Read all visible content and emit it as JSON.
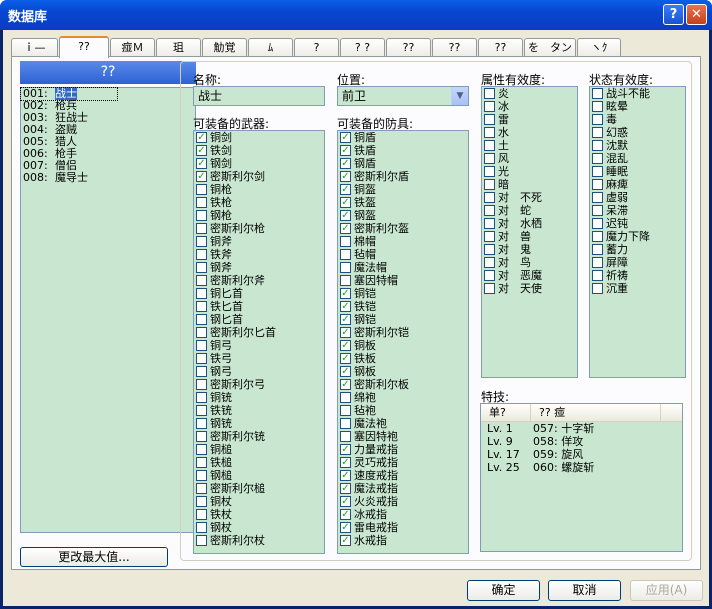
{
  "window": {
    "title": "数据库",
    "help_label": "?",
    "close_label": "✕"
  },
  "tabs": [
    "ｉ—",
    "??",
    "痖Ｍ",
    "珇",
    "觔覚",
    "ﾑ",
    "?",
    "? ?",
    "??",
    "??",
    "??",
    "を　タン",
    "ヽｸ"
  ],
  "left": {
    "header": "??",
    "button": "更改最大值...",
    "items": [
      {
        "num": "001:",
        "name": "战士"
      },
      {
        "num": "002:",
        "name": "枪兵"
      },
      {
        "num": "003:",
        "name": "狂战士"
      },
      {
        "num": "004:",
        "name": "盗贼"
      },
      {
        "num": "005:",
        "name": "猎人"
      },
      {
        "num": "006:",
        "name": "枪手"
      },
      {
        "num": "007:",
        "name": "僧侣"
      },
      {
        "num": "008:",
        "name": "魔导士"
      }
    ]
  },
  "form": {
    "name_label": "名称:",
    "name_value": "战士",
    "pos_label": "位置:",
    "pos_value": "前卫",
    "weapons_label": "可装备的武器:",
    "armor_label": "可装备的防具:",
    "attr_label": "属性有效度:",
    "state_label": "状态有效度:",
    "skill_label": "特技:"
  },
  "weapons": [
    {
      "t": "铜剑",
      "c": true
    },
    {
      "t": "铁剑",
      "c": true
    },
    {
      "t": "钢剑",
      "c": true
    },
    {
      "t": "密斯利尔剑",
      "c": true
    },
    {
      "t": "铜枪",
      "c": false
    },
    {
      "t": "铁枪",
      "c": false
    },
    {
      "t": "钢枪",
      "c": false
    },
    {
      "t": "密斯利尔枪",
      "c": false
    },
    {
      "t": "铜斧",
      "c": false
    },
    {
      "t": "铁斧",
      "c": false
    },
    {
      "t": "钢斧",
      "c": false
    },
    {
      "t": "密斯利尔斧",
      "c": false
    },
    {
      "t": "铜匕首",
      "c": false
    },
    {
      "t": "铁匕首",
      "c": false
    },
    {
      "t": "钢匕首",
      "c": false
    },
    {
      "t": "密斯利尔匕首",
      "c": false
    },
    {
      "t": "铜弓",
      "c": false
    },
    {
      "t": "铁弓",
      "c": false
    },
    {
      "t": "钢弓",
      "c": false
    },
    {
      "t": "密斯利尔弓",
      "c": false
    },
    {
      "t": "铜铳",
      "c": false
    },
    {
      "t": "铁铳",
      "c": false
    },
    {
      "t": "钢铳",
      "c": false
    },
    {
      "t": "密斯利尔铳",
      "c": false
    },
    {
      "t": "铜槌",
      "c": false
    },
    {
      "t": "铁槌",
      "c": false
    },
    {
      "t": "钢槌",
      "c": false
    },
    {
      "t": "密斯利尔槌",
      "c": false
    },
    {
      "t": "铜杖",
      "c": false
    },
    {
      "t": "铁杖",
      "c": false
    },
    {
      "t": "钢杖",
      "c": false
    },
    {
      "t": "密斯利尔杖",
      "c": false
    }
  ],
  "armor": [
    {
      "t": "铜盾",
      "c": true
    },
    {
      "t": "铁盾",
      "c": true
    },
    {
      "t": "钢盾",
      "c": true
    },
    {
      "t": "密斯利尔盾",
      "c": true
    },
    {
      "t": "铜盔",
      "c": true
    },
    {
      "t": "铁盔",
      "c": true
    },
    {
      "t": "钢盔",
      "c": true
    },
    {
      "t": "密斯利尔盔",
      "c": true
    },
    {
      "t": "棉帽",
      "c": false
    },
    {
      "t": "毡帽",
      "c": false
    },
    {
      "t": "魔法帽",
      "c": false
    },
    {
      "t": "塞因特帽",
      "c": false
    },
    {
      "t": "铜铠",
      "c": true
    },
    {
      "t": "铁铠",
      "c": true
    },
    {
      "t": "钢铠",
      "c": true
    },
    {
      "t": "密斯利尔铠",
      "c": true
    },
    {
      "t": "铜板",
      "c": true
    },
    {
      "t": "铁板",
      "c": true
    },
    {
      "t": "钢板",
      "c": true
    },
    {
      "t": "密斯利尔板",
      "c": true
    },
    {
      "t": "绵袍",
      "c": false
    },
    {
      "t": "毡袍",
      "c": false
    },
    {
      "t": "魔法袍",
      "c": false
    },
    {
      "t": "塞因特袍",
      "c": false
    },
    {
      "t": "力量戒指",
      "c": true
    },
    {
      "t": "灵巧戒指",
      "c": true
    },
    {
      "t": "速度戒指",
      "c": true
    },
    {
      "t": "魔法戒指",
      "c": true
    },
    {
      "t": "火炎戒指",
      "c": true
    },
    {
      "t": "冰戒指",
      "c": true
    },
    {
      "t": "雷电戒指",
      "c": true
    },
    {
      "t": "水戒指",
      "c": true
    }
  ],
  "attributes": [
    "炎",
    "冰",
    "雷",
    "水",
    "土",
    "风",
    "光",
    "暗",
    "对　不死",
    "对　蛇",
    "对　水栖",
    "对　兽",
    "对　鬼",
    "对　鸟",
    "对　恶魔",
    "对　天使"
  ],
  "states": [
    "战斗不能",
    "眩晕",
    "毒",
    "幻惑",
    "沈默",
    "混乱",
    "睡眠",
    "麻痺",
    "虚弱",
    "呆滞",
    "迟钝",
    "魔力下降",
    "蓄力",
    "屏障",
    "祈祷",
    "沉重"
  ],
  "skills": {
    "col1": "单?",
    "col2": "??  痖",
    "rows": [
      {
        "lv": "Lv.  1",
        "sk": "057: 十字斩"
      },
      {
        "lv": "Lv.  9",
        "sk": "058: 佯攻"
      },
      {
        "lv": "Lv. 17",
        "sk": "059: 旋风"
      },
      {
        "lv": "Lv. 25",
        "sk": "060: 螺旋斩"
      }
    ]
  },
  "buttons": {
    "ok": "确定",
    "cancel": "取消",
    "apply": "应用(A)"
  }
}
